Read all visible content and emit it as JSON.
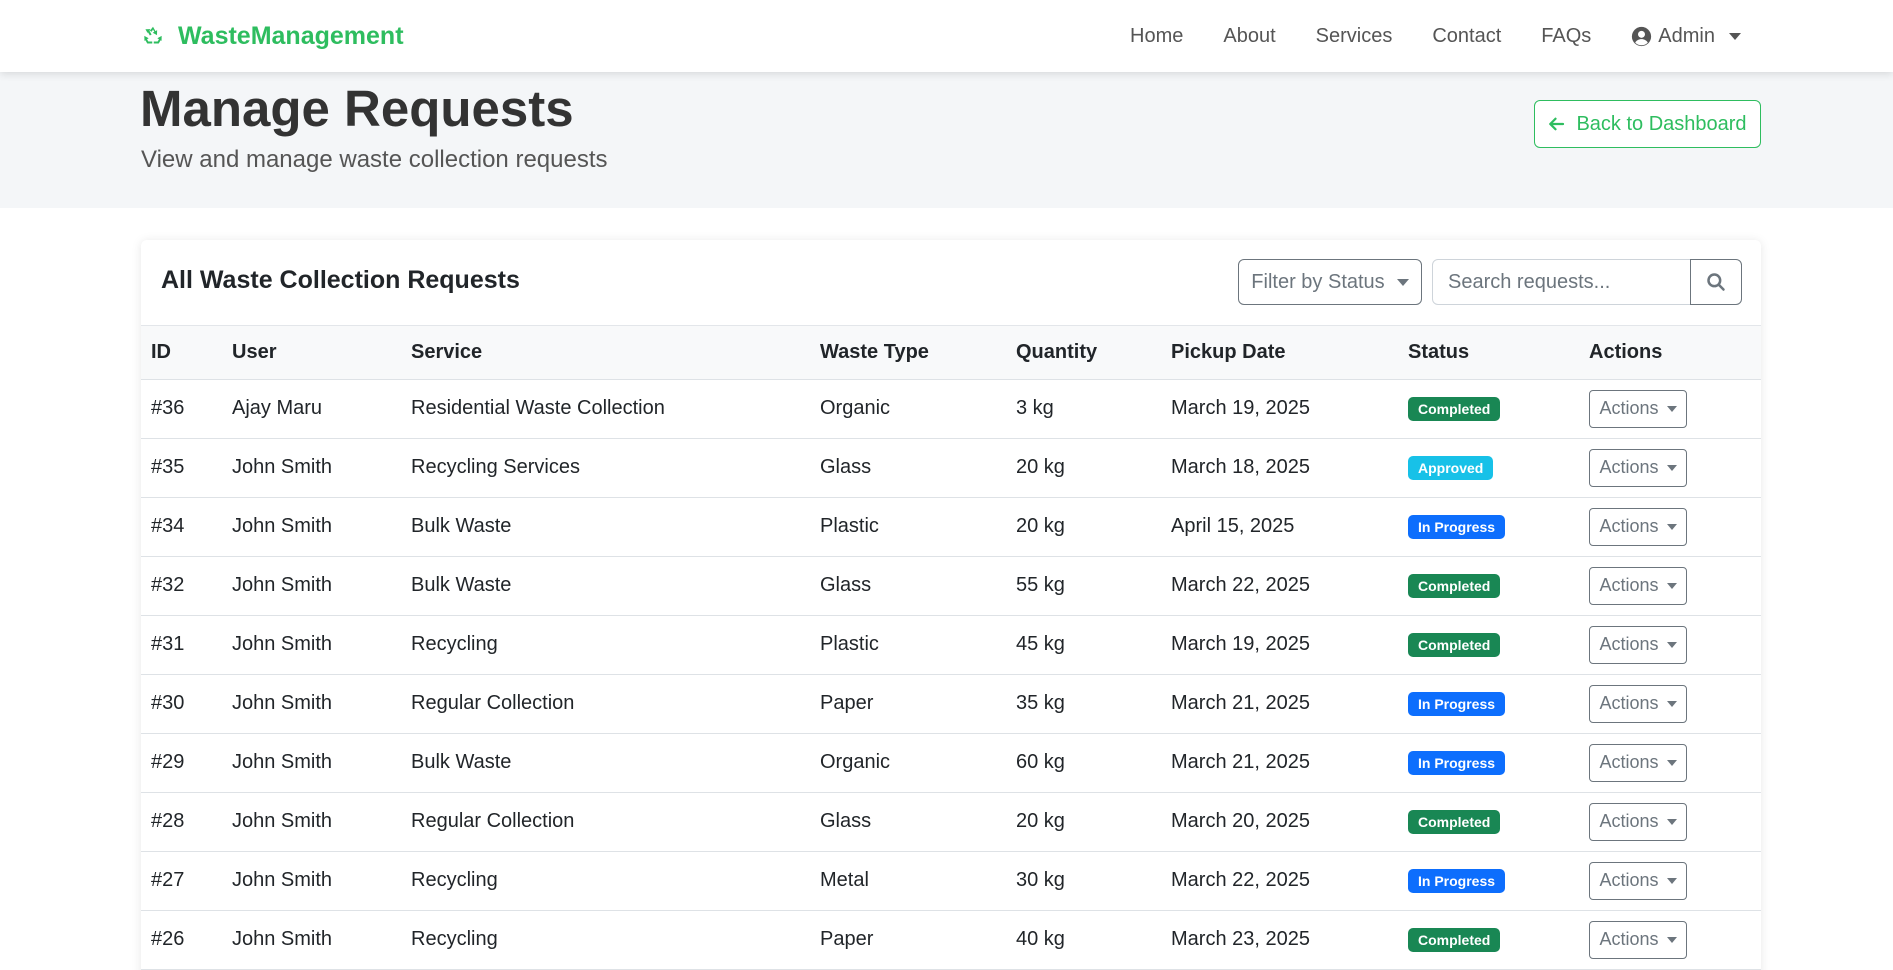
{
  "navbar": {
    "brand": "WasteManagement",
    "links": [
      "Home",
      "About",
      "Services",
      "Contact",
      "FAQs"
    ],
    "admin_label": "Admin"
  },
  "header": {
    "title": "Manage Requests",
    "subtitle": "View and manage waste collection requests",
    "back_label": "Back to Dashboard"
  },
  "card": {
    "title": "All Waste Collection Requests",
    "filter_label": "Filter by Status",
    "search_placeholder": "Search requests..."
  },
  "table": {
    "columns": [
      "ID",
      "User",
      "Service",
      "Waste Type",
      "Quantity",
      "Pickup Date",
      "Status",
      "Actions"
    ],
    "action_label": "Actions",
    "rows": [
      {
        "id": "#36",
        "user": "Ajay Maru",
        "service": "Residential Waste Collection",
        "waste_type": "Organic",
        "quantity": "3 kg",
        "pickup_date": "March 19, 2025",
        "status": "Completed",
        "status_kind": "completed"
      },
      {
        "id": "#35",
        "user": "John Smith",
        "service": "Recycling Services",
        "waste_type": "Glass",
        "quantity": "20 kg",
        "pickup_date": "March 18, 2025",
        "status": "Approved",
        "status_kind": "approved"
      },
      {
        "id": "#34",
        "user": "John Smith",
        "service": "Bulk Waste",
        "waste_type": "Plastic",
        "quantity": "20 kg",
        "pickup_date": "April 15, 2025",
        "status": "In Progress",
        "status_kind": "progress"
      },
      {
        "id": "#32",
        "user": "John Smith",
        "service": "Bulk Waste",
        "waste_type": "Glass",
        "quantity": "55 kg",
        "pickup_date": "March 22, 2025",
        "status": "Completed",
        "status_kind": "completed"
      },
      {
        "id": "#31",
        "user": "John Smith",
        "service": "Recycling",
        "waste_type": "Plastic",
        "quantity": "45 kg",
        "pickup_date": "March 19, 2025",
        "status": "Completed",
        "status_kind": "completed"
      },
      {
        "id": "#30",
        "user": "John Smith",
        "service": "Regular Collection",
        "waste_type": "Paper",
        "quantity": "35 kg",
        "pickup_date": "March 21, 2025",
        "status": "In Progress",
        "status_kind": "progress"
      },
      {
        "id": "#29",
        "user": "John Smith",
        "service": "Bulk Waste",
        "waste_type": "Organic",
        "quantity": "60 kg",
        "pickup_date": "March 21, 2025",
        "status": "In Progress",
        "status_kind": "progress"
      },
      {
        "id": "#28",
        "user": "John Smith",
        "service": "Regular Collection",
        "waste_type": "Glass",
        "quantity": "20 kg",
        "pickup_date": "March 20, 2025",
        "status": "Completed",
        "status_kind": "completed"
      },
      {
        "id": "#27",
        "user": "John Smith",
        "service": "Recycling",
        "waste_type": "Metal",
        "quantity": "30 kg",
        "pickup_date": "March 22, 2025",
        "status": "In Progress",
        "status_kind": "progress"
      },
      {
        "id": "#26",
        "user": "John Smith",
        "service": "Recycling",
        "waste_type": "Paper",
        "quantity": "40 kg",
        "pickup_date": "March 23, 2025",
        "status": "Completed",
        "status_kind": "completed"
      }
    ]
  },
  "icons": {
    "brand": "recycle-icon",
    "admin": "user-circle-icon",
    "back": "arrow-left-icon",
    "search": "search-icon"
  },
  "colors": {
    "brand_green": "#2ebd5f",
    "completed": "#198754",
    "approved": "#17c1e8",
    "in_progress": "#0d6efd"
  }
}
